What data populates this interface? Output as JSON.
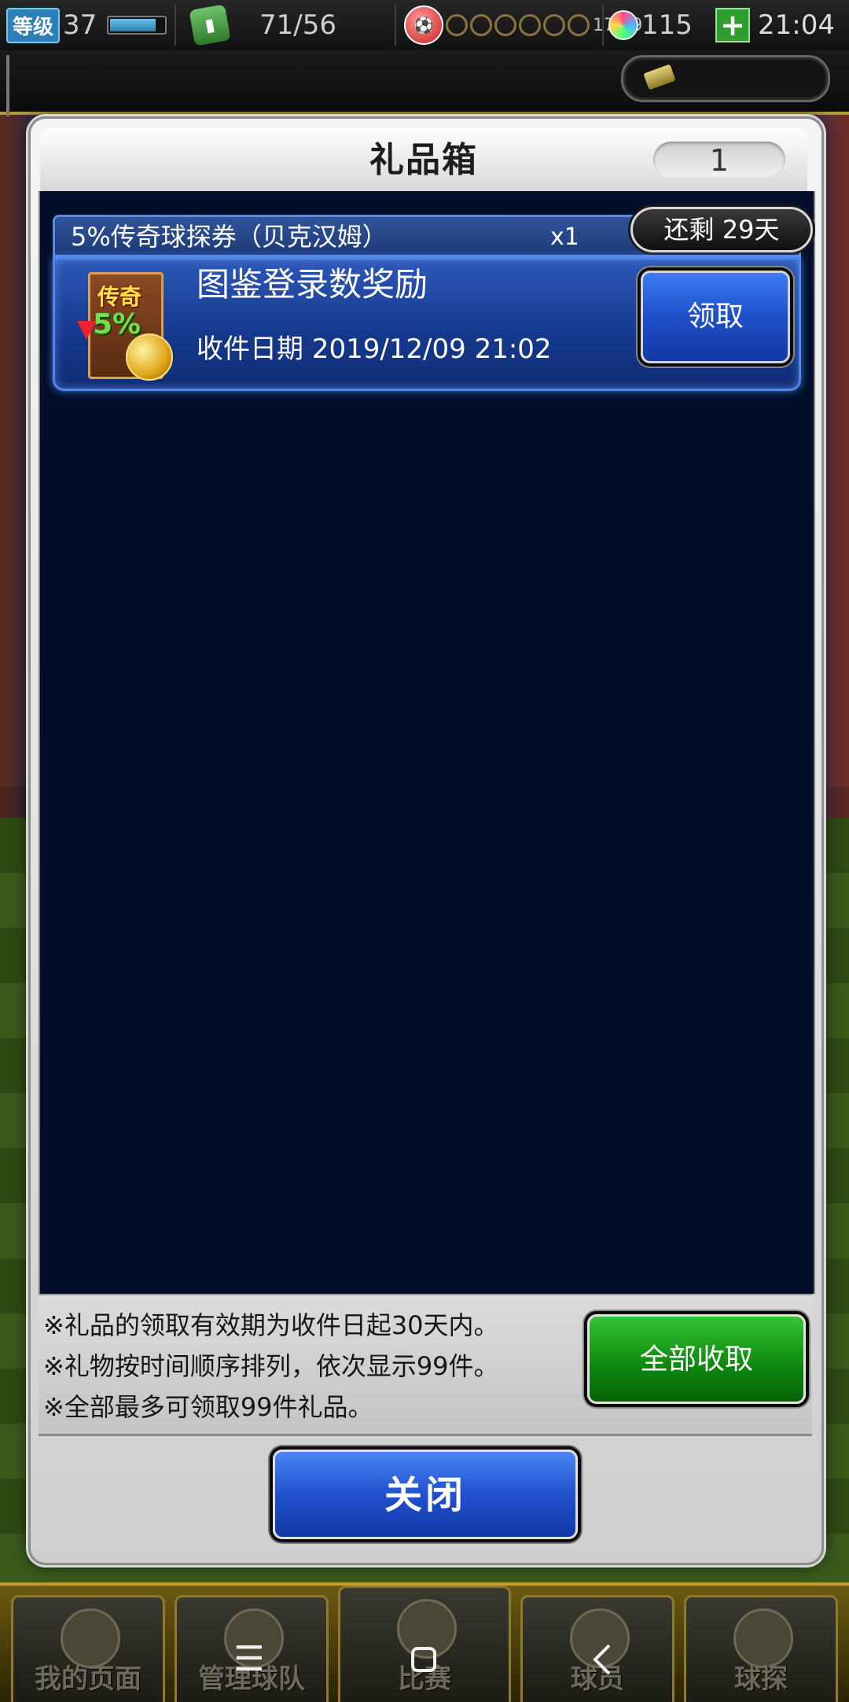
{
  "status_bar": {
    "level_label": "等级",
    "level_value": "37",
    "exp_progress": 0.85,
    "stamina": "71/56",
    "match_timer": "17:19",
    "gems": "115",
    "clock": "21:04"
  },
  "dialog": {
    "title": "礼品箱",
    "count": "1",
    "gift": {
      "name": "5%传奇球探券（贝克汉姆）",
      "quantity": "x1",
      "remaining": "还剩 29天",
      "icon_label_top": "传奇",
      "icon_label_bottom": "5%",
      "source": "图鉴登录数奖励",
      "date": "收件日期  2019/12/09 21:02",
      "claim_label": "领取"
    },
    "info_lines": [
      "※礼品的领取有效期为收件日起30天内。",
      "※礼物按时间顺序排列，依次显示99件。",
      "※全部最多可领取99件礼品。"
    ],
    "collect_all_label": "全部收取",
    "close_label": "关闭"
  },
  "game_nav": {
    "tabs": [
      "我的页面",
      "管理球队",
      "比赛",
      "球员",
      "球探"
    ]
  },
  "system_nav": {
    "menu_icon": "menu-icon",
    "home_icon": "home-icon",
    "back_icon": "back-icon"
  },
  "colors": {
    "accent_blue": "#1f4fc8",
    "accent_green": "#0f8a0f",
    "body_dark": "#020f2a"
  }
}
